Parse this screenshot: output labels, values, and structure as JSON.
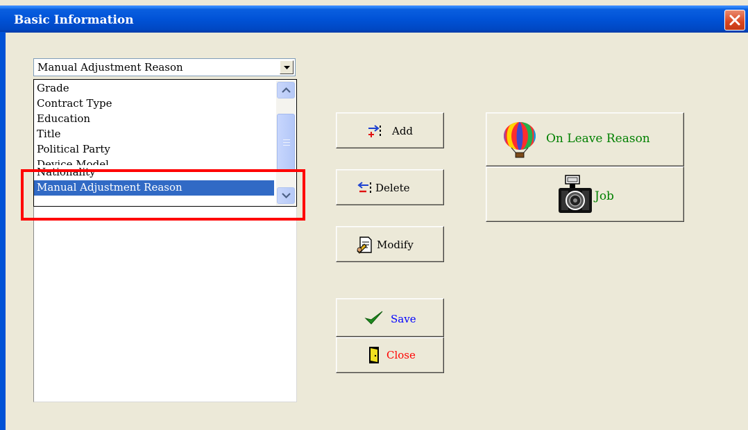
{
  "window": {
    "title": "Basic Information"
  },
  "combo": {
    "value": "Manual Adjustment Reason"
  },
  "dropdown": {
    "items": [
      "Grade",
      "Contract Type",
      "Education",
      "Title",
      "Political Party",
      "Device Model",
      "Nationality",
      "Manual Adjustment Reason"
    ],
    "selected_index": 7
  },
  "buttons": {
    "add": "Add",
    "delete": "Delete",
    "modify": "Modify",
    "save": "Save",
    "close": "Close",
    "on_leave_reason": "On Leave Reason",
    "job": "Job"
  },
  "colors": {
    "titlebar": "#0052d6",
    "window_bg": "#ece9d8",
    "selection": "#316ac5",
    "highlight": "#ff0000",
    "save_text": "#0000ff",
    "close_text": "#ff0000",
    "leave_text": "#008000"
  },
  "icons": {
    "add": "add-arrow-icon",
    "delete": "delete-arrow-icon",
    "modify": "modify-document-icon",
    "save": "checkmark-icon",
    "close": "door-exit-icon",
    "on_leave_reason": "hot-air-balloon-icon",
    "job": "camera-icon"
  }
}
